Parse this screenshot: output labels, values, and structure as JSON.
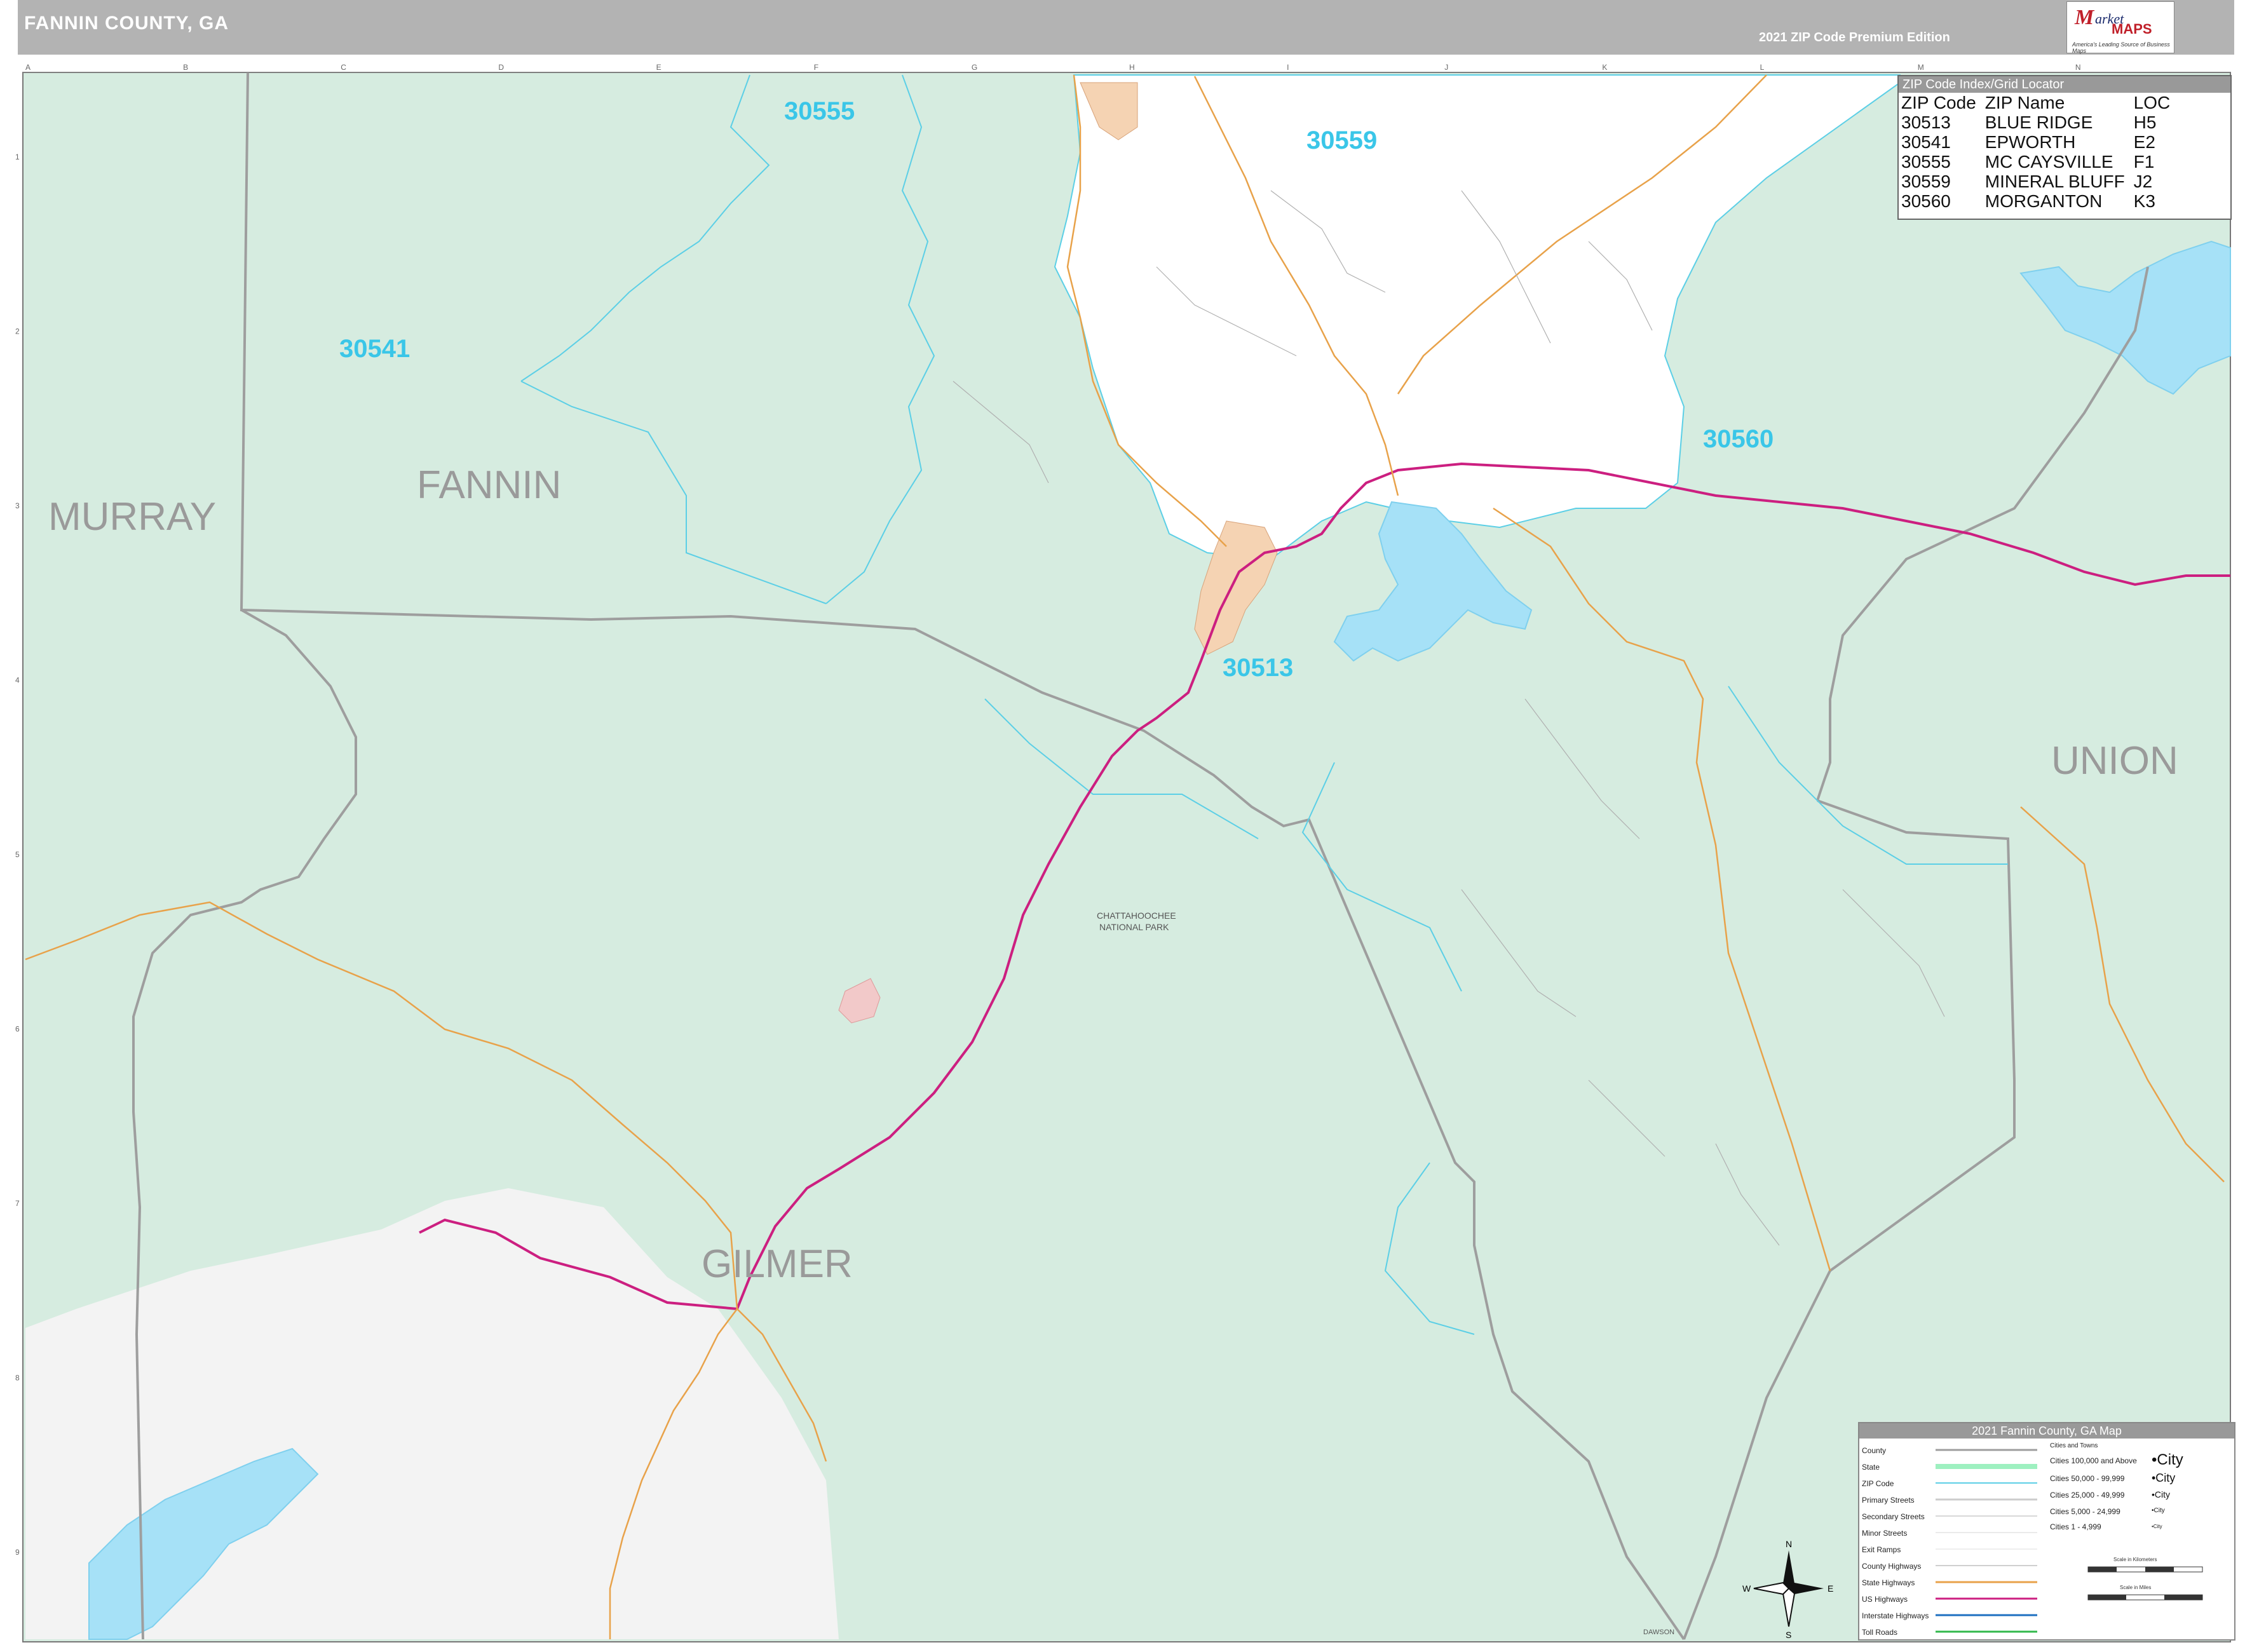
{
  "header": {
    "title": "FANNIN COUNTY, GA",
    "edition": "2021 ZIP Code Premium Edition",
    "logo": {
      "brand_top": "arket",
      "brand_initial": "M",
      "brand_maps": "MAPS",
      "tagline": "America's Leading Source of Business Maps"
    }
  },
  "grid": {
    "columns": [
      "A",
      "B",
      "C",
      "D",
      "E",
      "F",
      "G",
      "H",
      "I",
      "J",
      "K",
      "L",
      "M",
      "N"
    ],
    "rows": [
      "1",
      "2",
      "3",
      "4",
      "5",
      "6",
      "7",
      "8",
      "9"
    ]
  },
  "counties": {
    "murray": "MURRAY",
    "fannin": "FANNIN",
    "union": "UNION",
    "gilmer": "GILMER"
  },
  "zip_labels": {
    "z30555": "30555",
    "z30559": "30559",
    "z30541": "30541",
    "z30560": "30560",
    "z30513": "30513"
  },
  "places": {
    "park": "CHATTAHOOCHEE",
    "park2": "NATIONAL PARK",
    "dawson": "DAWSON"
  },
  "zip_index": {
    "title": "ZIP Code Index/Grid Locator",
    "headers": [
      "ZIP Code",
      "ZIP Name",
      "LOC"
    ],
    "rows": [
      [
        "30513",
        "BLUE RIDGE",
        "H5"
      ],
      [
        "30541",
        "EPWORTH",
        "E2"
      ],
      [
        "30555",
        "MC CAYSVILLE",
        "F1"
      ],
      [
        "30559",
        "MINERAL BLUFF",
        "J2"
      ],
      [
        "30560",
        "MORGANTON",
        "K3"
      ]
    ]
  },
  "legend": {
    "title": "2021 Fannin County, GA Map",
    "items": [
      "County",
      "State",
      "ZIP Code",
      "Primary Streets",
      "Secondary Streets",
      "Minor Streets",
      "Exit Ramps",
      "County Highways",
      "State Highways",
      "US Highways",
      "Interstate Highways",
      "Toll Roads"
    ],
    "cities_header": "Cities and Towns",
    "cities": [
      "Cities 100,000 and Above",
      "Cities 50,000 - 99,999",
      "Cities 25,000 - 49,999",
      "Cities 5,000 - 24,999",
      "Cities 1 - 4,999"
    ],
    "city_samples": [
      "•City",
      "•City",
      "•City",
      "•City",
      "•City"
    ],
    "scale_km": "Scale in Kilometers",
    "scale_mi": "Scale in Miles"
  },
  "compass": {
    "n": "N",
    "s": "S",
    "e": "E",
    "w": "W"
  },
  "colors": {
    "land_green": "#d6ece0",
    "land_white": "#ffffff",
    "land_gray": "#f2f2f2",
    "water": "#a6e1f7",
    "zip_boundary": "#5ccfe6",
    "county_boundary": "#9e9e9e",
    "us_highway": "#cc1f80",
    "state_highway": "#e8a24a",
    "city_fill": "#f5d3b3"
  }
}
